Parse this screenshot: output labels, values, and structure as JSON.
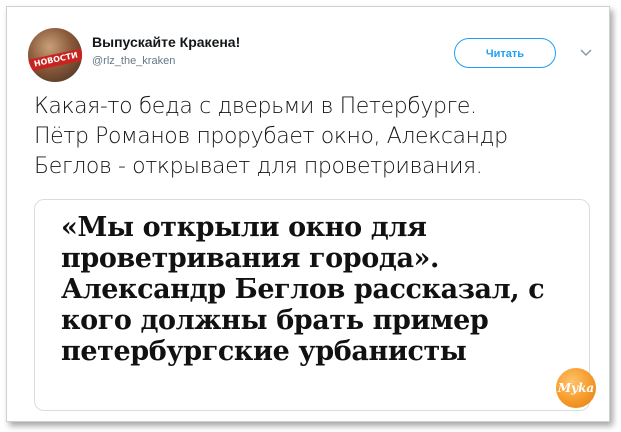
{
  "account": {
    "display_name": "Выпускайте Кракена!",
    "handle": "@rlz_the_kraken",
    "avatar_band_text": "НОВОСТИ"
  },
  "follow_button": {
    "label": "Читать"
  },
  "icons": {
    "menu": "chevron-down-icon"
  },
  "tweet": {
    "lines": [
      "Какая-то беда с дверьми в Петербурге.",
      "Пётр Романов прорубает окно, Александр",
      "Беглов - открывает для проветривания."
    ]
  },
  "media": {
    "lines": [
      "«Мы открыли окно для",
      "проветривания города».",
      "Александр Беглов рассказал, с",
      "кого должны брать пример",
      "петербургские урбанисты"
    ]
  },
  "watermark": {
    "text": "Мyka"
  },
  "colors": {
    "accent": "#1da1f2",
    "text": "#14171a",
    "muted": "#657786",
    "watermark": "#f59a2a"
  }
}
